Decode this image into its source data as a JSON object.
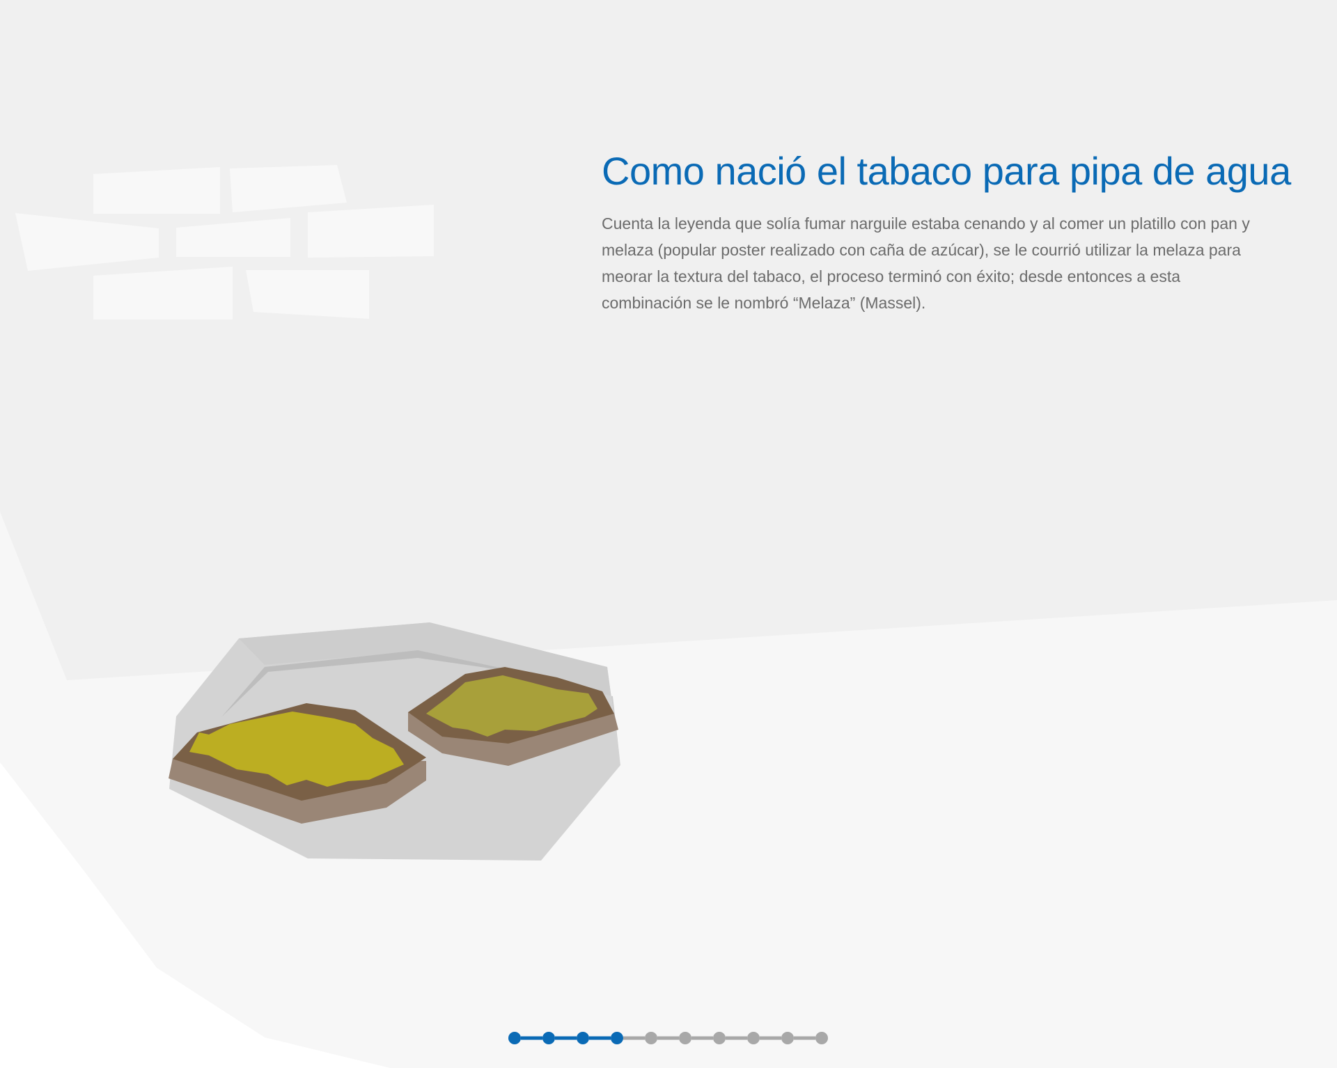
{
  "slide": {
    "title": "Como nació el tabaco para pipa de agua",
    "body": "Cuenta la leyenda que solía fumar narguile estaba cenando y al comer un platillo con pan y melaza (popular poster realizado con caña de azúcar), se le courrió  utilizar la melaza para meorar la textura del tabaco, el proceso terminó con éxito; desde entonces  a esta combinación se le nombró “Melaza” (Massel)."
  },
  "pagination": {
    "total_steps": 10,
    "current_step": 4
  },
  "colors": {
    "accent": "#0a6ab5",
    "inactive": "#a8a8a8",
    "background": "#f0f0f0",
    "floor": "#f7f7f7",
    "tray": "#d3d3d3",
    "bread_crust": "#7a6046",
    "bread_side": "#9a8676",
    "molasses_1": "#bcae22",
    "molasses_2": "#a8a03a"
  }
}
